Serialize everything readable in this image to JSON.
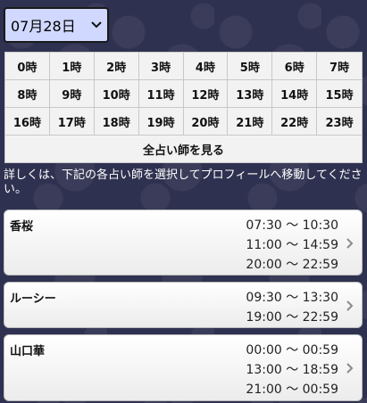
{
  "date_select": {
    "value": "07月28日"
  },
  "hours": [
    "0時",
    "1時",
    "2時",
    "3時",
    "4時",
    "5時",
    "6時",
    "7時",
    "8時",
    "9時",
    "10時",
    "11時",
    "12時",
    "13時",
    "14時",
    "15時",
    "16時",
    "17時",
    "18時",
    "19時",
    "20時",
    "21時",
    "22時",
    "23時"
  ],
  "all_fortune_tellers_label": "全占い師を見る",
  "notice": "詳しくは、下記の各占い師を選択してプロフィールへ移動してください。",
  "tellers": [
    {
      "name": "香桜",
      "times": [
        "07:30 〜 10:30",
        "11:00 〜 14:59",
        "20:00 〜 22:59"
      ]
    },
    {
      "name": "ルーシー",
      "times": [
        "09:30 〜 13:30",
        "19:00 〜 22:59"
      ]
    },
    {
      "name": "山口華",
      "times": [
        "00:00 〜 00:59",
        "13:00 〜 18:59",
        "21:00 〜 00:59"
      ]
    }
  ]
}
